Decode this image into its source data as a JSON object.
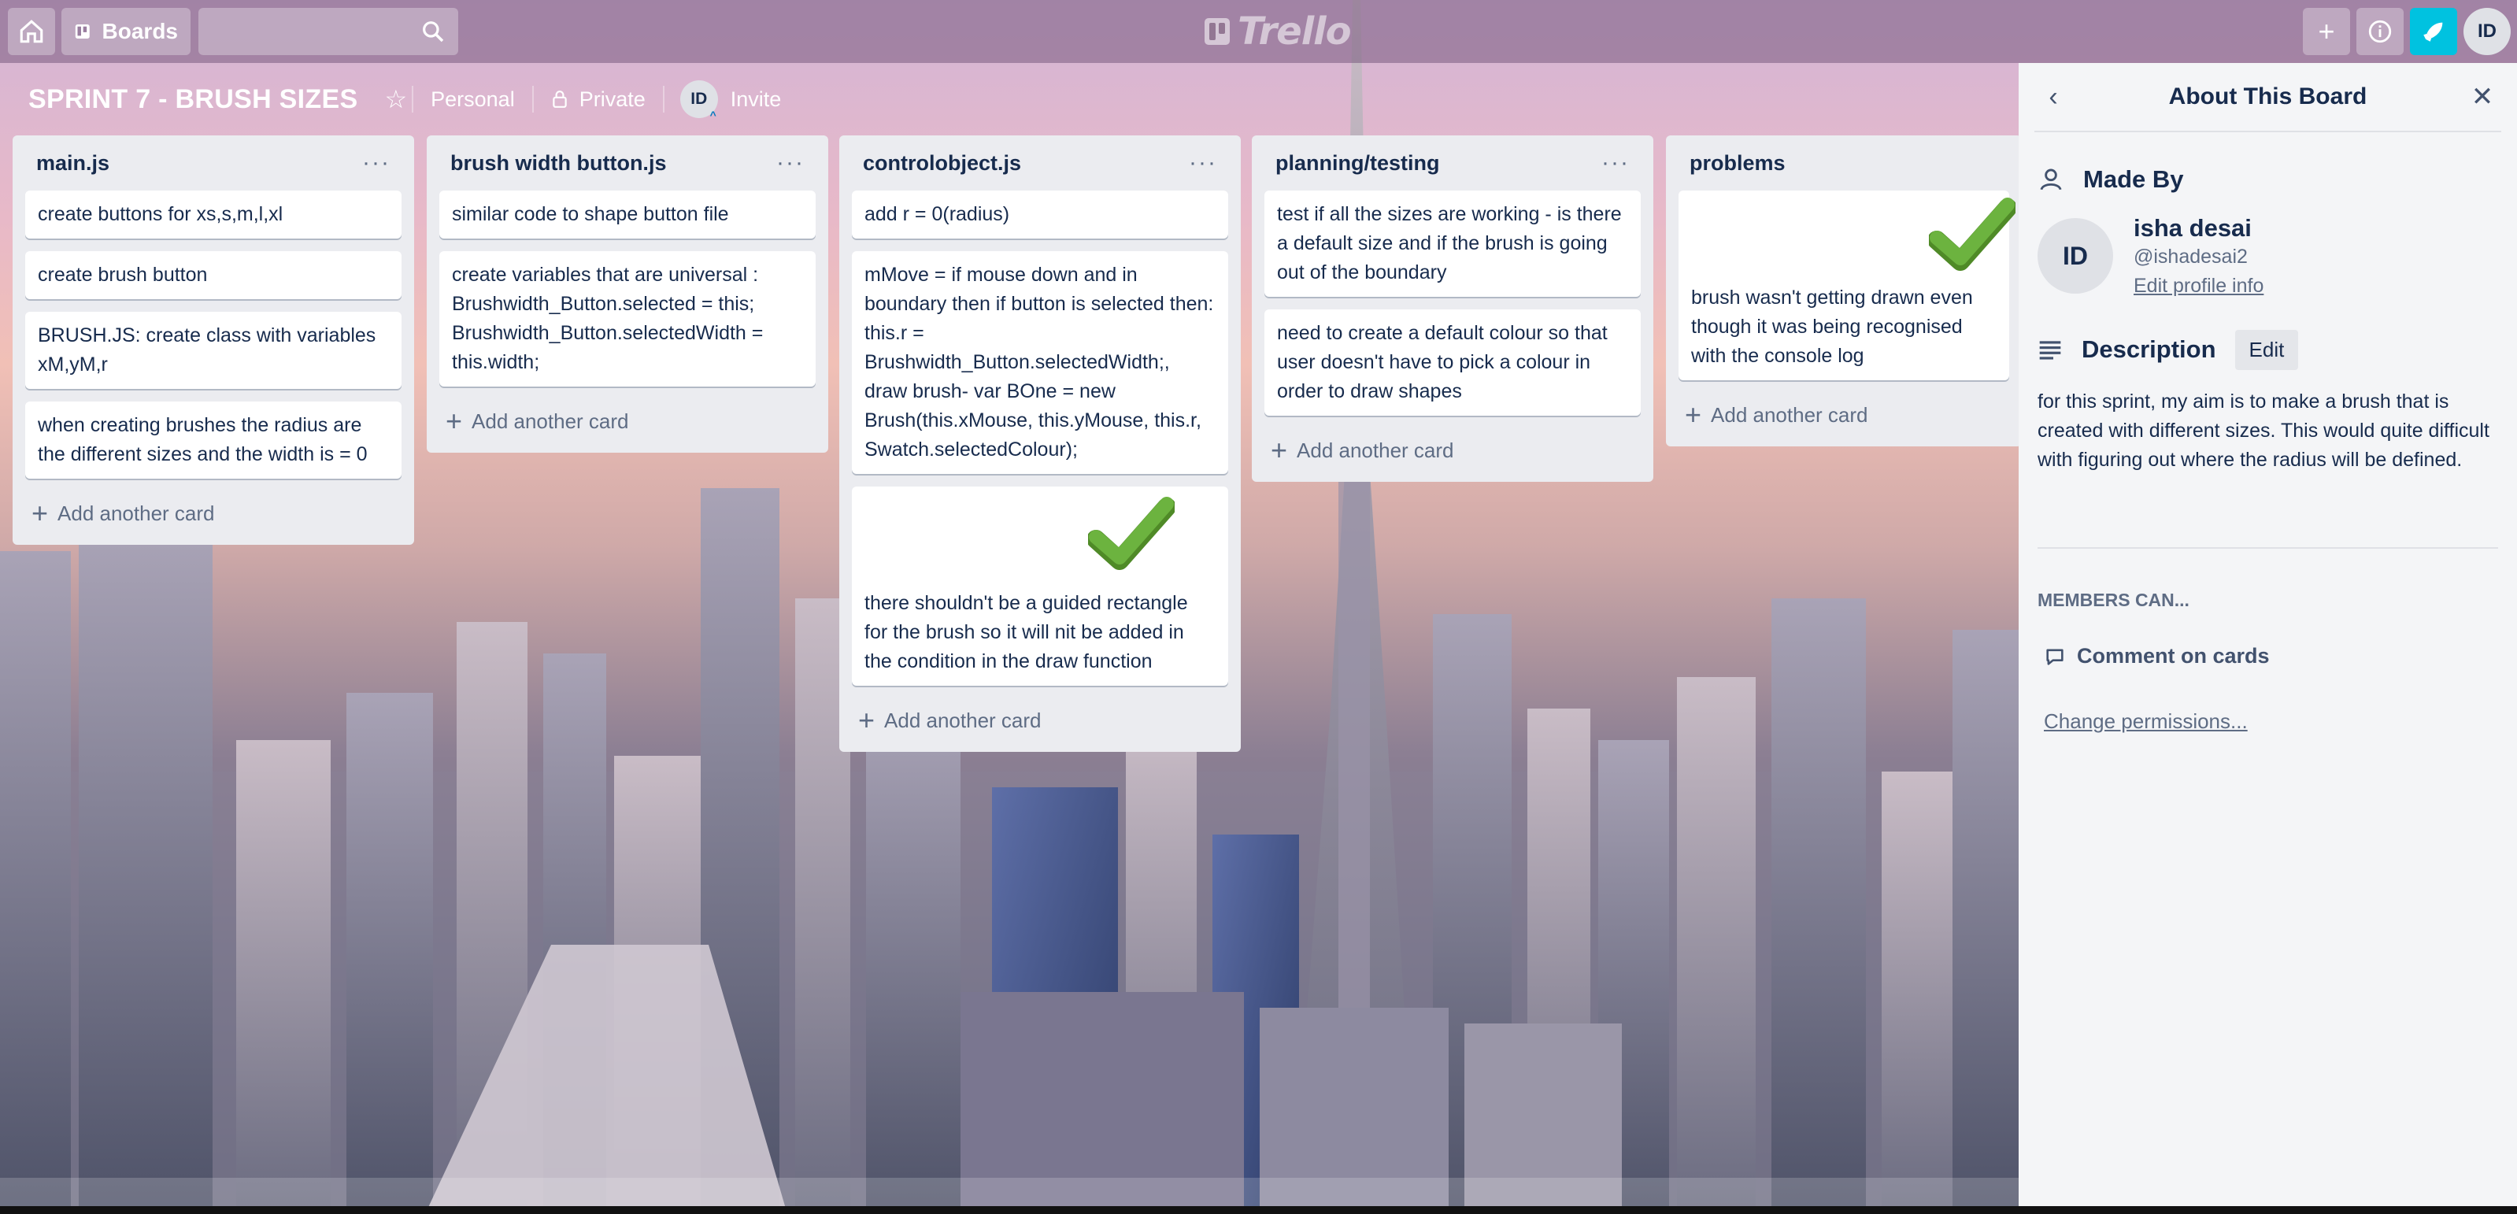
{
  "topbar": {
    "boards_label": "Boards",
    "search_placeholder": "",
    "logo_text": "Trello",
    "user_initials": "ID"
  },
  "board": {
    "title": "SPRINT 7 - BRUSH SIZES",
    "visibility_team": "Personal",
    "privacy": "Private",
    "member_initials": "ID",
    "invite_label": "Invite"
  },
  "lists": [
    {
      "title": "main.js",
      "cards": [
        "create buttons for xs,s,m,l,xl",
        "create brush button",
        "BRUSH.JS: create class with variables xM,yM,r",
        "when creating brushes the radius are the different sizes and the width is = 0"
      ],
      "add_label": "Add another card"
    },
    {
      "title": "brush width button.js",
      "cards": [
        "similar code to shape button file",
        "create variables that are universal : Brushwidth_Button.selected = this; Brushwidth_Button.selectedWidth = this.width;"
      ],
      "add_label": "Add another card"
    },
    {
      "title": "controlobject.js",
      "cards": [
        "add r = 0(radius)",
        "mMove = if mouse down and in boundary then if button is selected then: this.r = Brushwidth_Button.selectedWidth;, draw brush- var BOne = new Brush(this.xMouse, this.yMouse, this.r, Swatch.selectedColour);",
        "there shouldn't be a guided rectangle for the brush so it will nit be added in the condition in the draw function"
      ],
      "add_label": "Add another card"
    },
    {
      "title": "planning/testing",
      "cards": [
        "test if all the sizes are working - is there a default size and if the brush is going out of the boundary",
        "need to create a default colour so that user doesn't have to pick a colour in order to draw shapes"
      ],
      "add_label": "Add another card"
    },
    {
      "title": "problems",
      "cards": [
        "brush wasn't getting drawn even though it was being recognised with the console log"
      ],
      "add_label": "Add another card"
    }
  ],
  "panel": {
    "title": "About This Board",
    "made_by_label": "Made By",
    "user_initials": "ID",
    "user_name": "isha desai",
    "user_handle": "@ishadesai2",
    "edit_profile_label": "Edit profile info",
    "description_label": "Description",
    "edit_label": "Edit",
    "description_text": "for this sprint, my aim is to make a brush that is created with different sizes. This would quite difficult with figuring out where the radius will be defined.",
    "members_can_label": "MEMBERS CAN...",
    "comment_label": "Comment on cards",
    "change_permissions_label": "Change permissions..."
  },
  "colors": {
    "accent_cyan": "#00c2e0",
    "check_green": "#6cb33f",
    "list_bg": "#ebecf0",
    "panel_bg": "#f4f5f7"
  }
}
